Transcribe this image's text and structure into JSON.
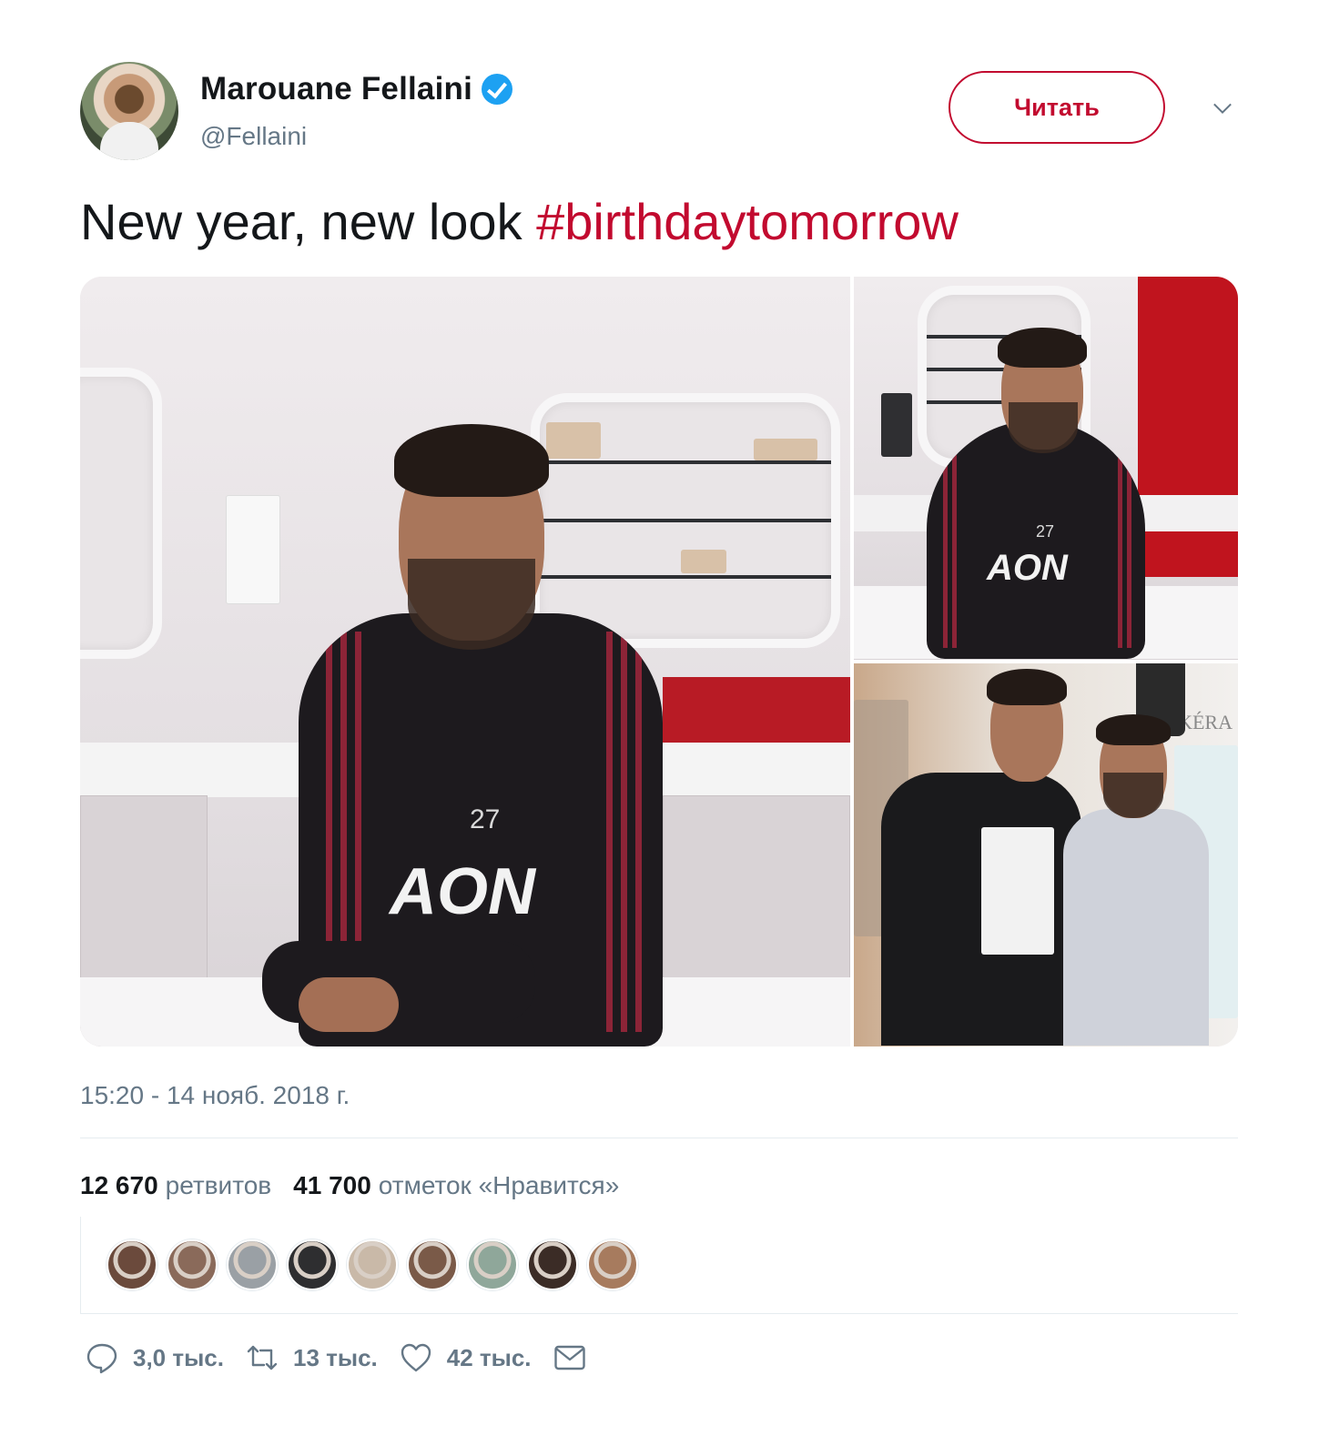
{
  "user": {
    "display_name": "Marouane Fellaini",
    "handle": "@Fellaini",
    "verified": true
  },
  "follow_button": {
    "label": "Читать",
    "color": "#c20a2f"
  },
  "tweet": {
    "text": "New year, new look ",
    "hashtag": "#birthdaytomorrow",
    "timestamp": "15:20 - 14 нояб. 2018 г."
  },
  "media": {
    "photos": [
      {
        "jersey_number": "27",
        "sponsor": "AON"
      },
      {
        "jersey_number": "27",
        "sponsor": "AON"
      },
      {
        "sign_text": "KÉRA"
      }
    ]
  },
  "stats": {
    "retweets_count": "12 670",
    "retweets_label": "ретвитов",
    "likes_count": "41 700",
    "likes_label": "отметок «Нравится»"
  },
  "likers": [
    {
      "color": "#6b4a3c"
    },
    {
      "color": "#8a6a5a"
    },
    {
      "color": "#9aa0a5"
    },
    {
      "color": "#2e2e30"
    },
    {
      "color": "#c9b9a8"
    },
    {
      "color": "#7a5a48"
    },
    {
      "color": "#8fa79a"
    },
    {
      "color": "#3b2c26"
    },
    {
      "color": "#a77b5e"
    }
  ],
  "actions": {
    "reply_count": "3,0 тыс.",
    "retweet_count": "13 тыс.",
    "like_count": "42 тыс.",
    "icons": [
      "reply-icon",
      "retweet-icon",
      "like-icon",
      "direct-message-icon"
    ]
  },
  "colors": {
    "accent": "#c20a2f",
    "secondary_text": "#657786",
    "verified": "#1da1f2"
  }
}
